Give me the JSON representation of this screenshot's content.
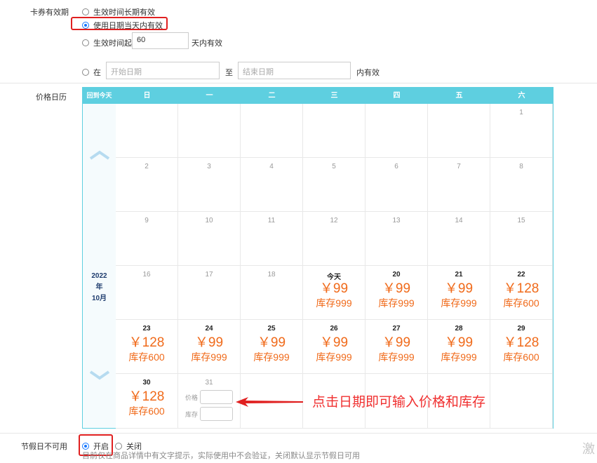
{
  "validity": {
    "label": "卡券有效期",
    "opt1": "生效时间长期有效",
    "opt2": "使用日期当天内有效",
    "opt3_prefix": "生效时间起",
    "opt3_value": "60",
    "opt3_suffix": "天内有效",
    "opt4_prefix": "在",
    "start_placeholder": "开始日期",
    "to": "至",
    "end_placeholder": "结束日期",
    "opt4_suffix": "内有效"
  },
  "calendar": {
    "label": "价格日历",
    "back_today": "回到今天",
    "weekdays": [
      "日",
      "一",
      "二",
      "三",
      "四",
      "五",
      "六"
    ],
    "year": "2022",
    "year_unit": "年",
    "month": "10月",
    "price_label": "价格",
    "stock_label": "库存",
    "rows": [
      [
        null,
        null,
        null,
        null,
        null,
        null,
        {
          "d": "1"
        }
      ],
      [
        {
          "d": "2"
        },
        {
          "d": "3"
        },
        {
          "d": "4"
        },
        {
          "d": "5"
        },
        {
          "d": "6"
        },
        {
          "d": "7"
        },
        {
          "d": "8"
        }
      ],
      [
        {
          "d": "9"
        },
        {
          "d": "10"
        },
        {
          "d": "11"
        },
        {
          "d": "12"
        },
        {
          "d": "13"
        },
        {
          "d": "14"
        },
        {
          "d": "15"
        }
      ],
      [
        {
          "d": "16"
        },
        {
          "d": "17"
        },
        {
          "d": "18"
        },
        {
          "d": "今天",
          "bold": true,
          "price": "￥99",
          "stock": "库存999"
        },
        {
          "d": "20",
          "bold": true,
          "price": "￥99",
          "stock": "库存999"
        },
        {
          "d": "21",
          "bold": true,
          "price": "￥99",
          "stock": "库存999"
        },
        {
          "d": "22",
          "bold": true,
          "price": "￥128",
          "stock": "库存600"
        }
      ],
      [
        {
          "d": "23",
          "bold": true,
          "price": "￥128",
          "stock": "库存600"
        },
        {
          "d": "24",
          "bold": true,
          "price": "￥99",
          "stock": "库存999"
        },
        {
          "d": "25",
          "bold": true,
          "price": "￥99",
          "stock": "库存999"
        },
        {
          "d": "26",
          "bold": true,
          "price": "￥99",
          "stock": "库存999"
        },
        {
          "d": "27",
          "bold": true,
          "price": "￥99",
          "stock": "库存999"
        },
        {
          "d": "28",
          "bold": true,
          "price": "￥99",
          "stock": "库存999"
        },
        {
          "d": "29",
          "bold": true,
          "price": "￥128",
          "stock": "库存600"
        }
      ],
      [
        {
          "d": "30",
          "bold": true,
          "price": "￥128",
          "stock": "库存600"
        },
        {
          "d": "31",
          "edit": true
        },
        null,
        null,
        null,
        null,
        null
      ]
    ]
  },
  "annotation": "点击日期即可输入价格和库存",
  "holiday": {
    "label": "节假日不可用",
    "on": "开启",
    "off": "关闭",
    "hint": "目前仅在商品详情中有文字提示，实际使用中不会验证，关闭默认显示节假日可用"
  },
  "watermark": "激"
}
